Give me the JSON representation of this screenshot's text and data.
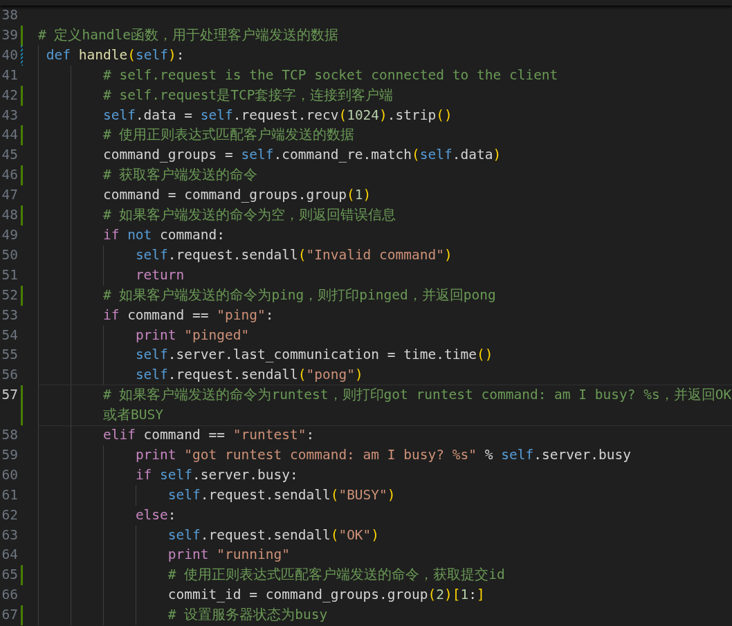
{
  "editor": {
    "lines": [
      {
        "number": "38",
        "current": false,
        "added": false,
        "modified": false
      },
      {
        "number": "39",
        "current": false,
        "added": true,
        "modified": false,
        "kind": "top",
        "tokens": [
          {
            "kind": "comment",
            "text": "# 定义handle函数，用于处理客户端发送的数据"
          }
        ]
      },
      {
        "number": "40",
        "current": false,
        "added": false,
        "modified": true,
        "kind": "decl",
        "tokens": [
          {
            "kind": "keyword",
            "text": "def"
          },
          {
            "kind": "function",
            "text": " handle"
          },
          {
            "kind": "bracket",
            "text": "("
          },
          {
            "kind": "self",
            "text": "self"
          },
          {
            "kind": "bracket",
            "text": ")"
          },
          {
            "kind": "plain",
            "text": ":"
          }
        ]
      },
      {
        "number": "41",
        "current": false,
        "added": false,
        "modified": false,
        "kind": "body",
        "tokens": [
          {
            "kind": "comment",
            "text": "# self.request is the TCP socket connected to the client"
          }
        ]
      },
      {
        "number": "42",
        "current": false,
        "added": true,
        "modified": false,
        "kind": "body",
        "tokens": [
          {
            "kind": "comment",
            "text": "# self.request是TCP套接字，连接到客户端"
          }
        ]
      },
      {
        "number": "43",
        "current": false,
        "added": false,
        "modified": false,
        "kind": "body",
        "tokens": [
          {
            "kind": "self",
            "text": "self"
          },
          {
            "kind": "plain",
            "text": ".data = "
          },
          {
            "kind": "self",
            "text": "self"
          },
          {
            "kind": "plain",
            "text": ".request.recv"
          },
          {
            "kind": "bracket",
            "text": "("
          },
          {
            "kind": "number",
            "text": "1024"
          },
          {
            "kind": "bracket",
            "text": ")"
          },
          {
            "kind": "plain",
            "text": ".strip"
          },
          {
            "kind": "bracket",
            "text": "()"
          }
        ]
      },
      {
        "number": "44",
        "current": false,
        "added": true,
        "modified": false,
        "kind": "body",
        "tokens": [
          {
            "kind": "comment",
            "text": "# 使用正则表达式匹配客户端发送的数据"
          }
        ]
      },
      {
        "number": "45",
        "current": false,
        "added": false,
        "modified": false,
        "kind": "body",
        "tokens": [
          {
            "kind": "plain",
            "text": "command_groups = "
          },
          {
            "kind": "self",
            "text": "self"
          },
          {
            "kind": "plain",
            "text": ".command_re.match"
          },
          {
            "kind": "bracket",
            "text": "("
          },
          {
            "kind": "self",
            "text": "self"
          },
          {
            "kind": "plain",
            "text": ".data"
          },
          {
            "kind": "bracket",
            "text": ")"
          }
        ]
      },
      {
        "number": "46",
        "current": false,
        "added": true,
        "modified": false,
        "kind": "body",
        "tokens": [
          {
            "kind": "comment",
            "text": "# 获取客户端发送的命令"
          }
        ]
      },
      {
        "number": "47",
        "current": false,
        "added": false,
        "modified": false,
        "kind": "body",
        "tokens": [
          {
            "kind": "plain",
            "text": "command = command_groups.group"
          },
          {
            "kind": "bracket",
            "text": "("
          },
          {
            "kind": "number",
            "text": "1"
          },
          {
            "kind": "bracket",
            "text": ")"
          }
        ]
      },
      {
        "number": "48",
        "current": false,
        "added": true,
        "modified": false,
        "kind": "body",
        "tokens": [
          {
            "kind": "comment",
            "text": "# 如果客户端发送的命令为空，则返回错误信息"
          }
        ]
      },
      {
        "number": "49",
        "current": false,
        "added": false,
        "modified": false,
        "kind": "body",
        "tokens": [
          {
            "kind": "control",
            "text": "if"
          },
          {
            "kind": "keyword",
            "text": " not"
          },
          {
            "kind": "plain",
            "text": " command:"
          }
        ]
      },
      {
        "number": "50",
        "current": false,
        "added": false,
        "modified": false,
        "kind": "nested",
        "tokens": [
          {
            "kind": "self",
            "text": "self"
          },
          {
            "kind": "plain",
            "text": ".request.sendall"
          },
          {
            "kind": "bracket",
            "text": "("
          },
          {
            "kind": "string",
            "text": "\"Invalid command\""
          },
          {
            "kind": "bracket",
            "text": ")"
          }
        ]
      },
      {
        "number": "51",
        "current": false,
        "added": false,
        "modified": false,
        "kind": "nested",
        "tokens": [
          {
            "kind": "control",
            "text": "return"
          }
        ]
      },
      {
        "number": "52",
        "current": false,
        "added": true,
        "modified": false,
        "kind": "body",
        "tokens": [
          {
            "kind": "comment",
            "text": "# 如果客户端发送的命令为ping，则打印pinged，并返回pong"
          }
        ]
      },
      {
        "number": "53",
        "current": false,
        "added": false,
        "modified": false,
        "kind": "body",
        "tokens": [
          {
            "kind": "control",
            "text": "if"
          },
          {
            "kind": "plain",
            "text": " command == "
          },
          {
            "kind": "string",
            "text": "\"ping\""
          },
          {
            "kind": "plain",
            "text": ":"
          }
        ]
      },
      {
        "number": "54",
        "current": false,
        "added": false,
        "modified": false,
        "kind": "nested",
        "tokens": [
          {
            "kind": "control",
            "text": "print"
          },
          {
            "kind": "string",
            "text": " \"pinged\""
          }
        ]
      },
      {
        "number": "55",
        "current": false,
        "added": false,
        "modified": false,
        "kind": "nested",
        "tokens": [
          {
            "kind": "self",
            "text": "self"
          },
          {
            "kind": "plain",
            "text": ".server.last_communication = time.time"
          },
          {
            "kind": "bracket",
            "text": "()"
          }
        ]
      },
      {
        "number": "56",
        "current": false,
        "added": false,
        "modified": false,
        "kind": "nested",
        "tokens": [
          {
            "kind": "self",
            "text": "self"
          },
          {
            "kind": "plain",
            "text": ".request.sendall"
          },
          {
            "kind": "bracket",
            "text": "("
          },
          {
            "kind": "string",
            "text": "\"pong\""
          },
          {
            "kind": "bracket",
            "text": ")"
          }
        ]
      },
      {
        "number": "57",
        "current": true,
        "added": true,
        "modified": false,
        "kind": "body",
        "tokens": [
          {
            "kind": "comment",
            "text": "# 如果客户端发送的命令为runtest，则打印got runtest command: am I busy? %s，并返回OK或者BUSY"
          }
        ]
      },
      {
        "number": "58",
        "current": false,
        "added": false,
        "modified": false,
        "kind": "body",
        "tokens": [
          {
            "kind": "control",
            "text": "elif"
          },
          {
            "kind": "plain",
            "text": " command == "
          },
          {
            "kind": "string",
            "text": "\"runtest\""
          },
          {
            "kind": "plain",
            "text": ":"
          }
        ]
      },
      {
        "number": "59",
        "current": false,
        "added": false,
        "modified": false,
        "kind": "nested",
        "tokens": [
          {
            "kind": "control",
            "text": "print"
          },
          {
            "kind": "string",
            "text": " \"got runtest command: am I busy? %s\""
          },
          {
            "kind": "plain",
            "text": " % "
          },
          {
            "kind": "self",
            "text": "self"
          },
          {
            "kind": "plain",
            "text": ".server.busy"
          }
        ]
      },
      {
        "number": "60",
        "current": false,
        "added": false,
        "modified": false,
        "kind": "nested",
        "tokens": [
          {
            "kind": "control",
            "text": "if"
          },
          {
            "kind": "self",
            "text": " self"
          },
          {
            "kind": "plain",
            "text": ".server.busy:"
          }
        ]
      },
      {
        "number": "61",
        "current": false,
        "added": false,
        "modified": false,
        "kind": "deep",
        "tokens": [
          {
            "kind": "self",
            "text": "self"
          },
          {
            "kind": "plain",
            "text": ".request.sendall"
          },
          {
            "kind": "bracket",
            "text": "("
          },
          {
            "kind": "string",
            "text": "\"BUSY\""
          },
          {
            "kind": "bracket",
            "text": ")"
          }
        ]
      },
      {
        "number": "62",
        "current": false,
        "added": false,
        "modified": false,
        "kind": "nested",
        "tokens": [
          {
            "kind": "control",
            "text": "else"
          },
          {
            "kind": "plain",
            "text": ":"
          }
        ]
      },
      {
        "number": "63",
        "current": false,
        "added": false,
        "modified": false,
        "kind": "deep",
        "tokens": [
          {
            "kind": "self",
            "text": "self"
          },
          {
            "kind": "plain",
            "text": ".request.sendall"
          },
          {
            "kind": "bracket",
            "text": "("
          },
          {
            "kind": "string",
            "text": "\"OK\""
          },
          {
            "kind": "bracket",
            "text": ")"
          }
        ]
      },
      {
        "number": "64",
        "current": false,
        "added": false,
        "modified": false,
        "kind": "deep",
        "tokens": [
          {
            "kind": "control",
            "text": "print"
          },
          {
            "kind": "string",
            "text": " \"running\""
          }
        ]
      },
      {
        "number": "65",
        "current": false,
        "added": true,
        "modified": false,
        "kind": "deep",
        "tokens": [
          {
            "kind": "comment",
            "text": "# 使用正则表达式匹配客户端发送的命令，获取提交id"
          }
        ]
      },
      {
        "number": "66",
        "current": false,
        "added": false,
        "modified": false,
        "kind": "deep",
        "tokens": [
          {
            "kind": "plain",
            "text": "commit_id = command_groups.group"
          },
          {
            "kind": "bracket",
            "text": "("
          },
          {
            "kind": "number",
            "text": "2"
          },
          {
            "kind": "bracket",
            "text": ")"
          },
          {
            "kind": "bracket",
            "text": "["
          },
          {
            "kind": "number",
            "text": "1"
          },
          {
            "kind": "plain",
            "text": ":"
          },
          {
            "kind": "bracket",
            "text": "]"
          }
        ]
      },
      {
        "number": "67",
        "current": false,
        "added": true,
        "modified": false,
        "kind": "deep",
        "tokens": [
          {
            "kind": "comment",
            "text": "# 设置服务器状态为busy"
          }
        ]
      }
    ]
  }
}
